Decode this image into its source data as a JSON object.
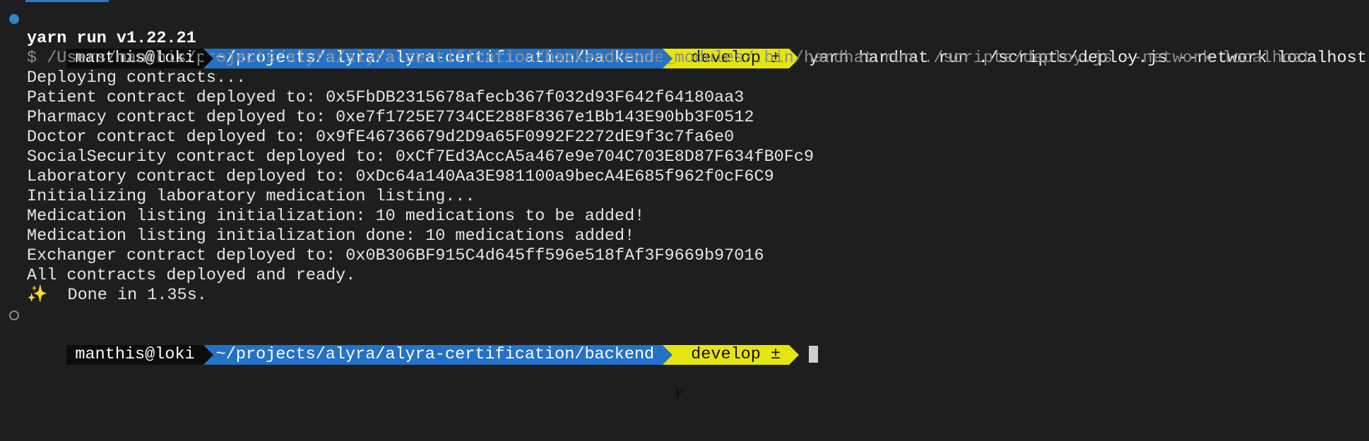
{
  "prompt": {
    "user_host": "manthis@loki",
    "path": "~/projects/alyra/alyra-certification/backend",
    "branch": "develop ±"
  },
  "command": "yarn hardhat run ./scripts/deploy.js --network localhost",
  "output": {
    "yarn_version": "yarn run v1.22.21",
    "exec_line": "$ /Users/manthis/projects/alyra/alyra-certification/backend/node_modules/.bin/hardhat run ./scripts/deploy.js --network localhost",
    "lines": [
      "Deploying contracts...",
      "Patient contract deployed to: 0x5FbDB2315678afecb367f032d93F642f64180aa3",
      "Pharmacy contract deployed to: 0xe7f1725E7734CE288F8367e1Bb143E90bb3F0512",
      "Doctor contract deployed to: 0x9fE46736679d2D9a65F0992F2272dE9f3c7fa6e0",
      "SocialSecurity contract deployed to: 0xCf7Ed3AccA5a467e9e704C703E8D87F634fB0Fc9",
      "Laboratory contract deployed to: 0xDc64a140Aa3E981100a9becA4E685f962f0cF6C9",
      "Initializing laboratory medication listing...",
      "Medication listing initialization: 10 medications to be added!",
      "Medication listing initialization done: 10 medications added!",
      "Exchanger contract deployed to: 0x0B306BF915C4d645ff596e518fAf3F9669b97016",
      "All contracts deployed and ready."
    ],
    "sparkle": "✨",
    "done": "  Done in 1.35s."
  },
  "colors": {
    "background": "#1e1e1e",
    "user_segment": "#0c0c0c",
    "path_segment": "#2472c8",
    "git_segment": "#e5e510",
    "success_marker": "#2f86c8"
  }
}
